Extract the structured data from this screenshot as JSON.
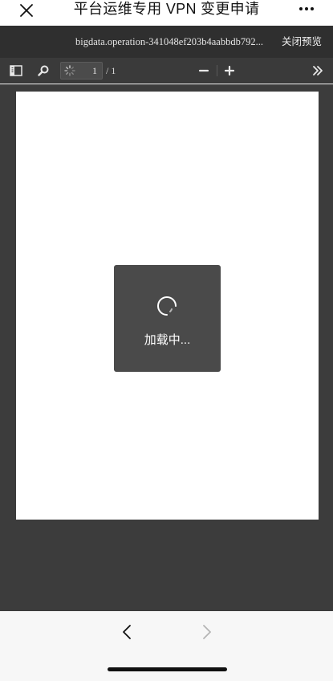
{
  "navbar": {
    "title": "平台运维专用 VPN 变更申请",
    "close_icon": "close-icon",
    "more_icon": "more-dots-icon"
  },
  "preview": {
    "filename": "bigdata.operation-341048ef203b4aabbdb792...",
    "close_label": "关闭预览"
  },
  "toolbar": {
    "sidebar_icon": "sidebar-toggle-icon",
    "search_icon": "search-icon",
    "page_current": "1",
    "page_total": "/ 1",
    "zoom_out_icon": "minus-icon",
    "zoom_in_icon": "plus-icon",
    "tools_icon": "double-chevron-right-icon"
  },
  "viewer": {
    "loading_text": "加载中..."
  },
  "bottombar": {
    "back_icon": "chevron-left-icon",
    "forward_icon": "chevron-right-icon"
  },
  "colors": {
    "dark_bar": "#2f2f2f",
    "toolbar": "#3a3a3a",
    "viewer_bg": "#3c3c3c",
    "loading_box": "#4a4a4a"
  }
}
